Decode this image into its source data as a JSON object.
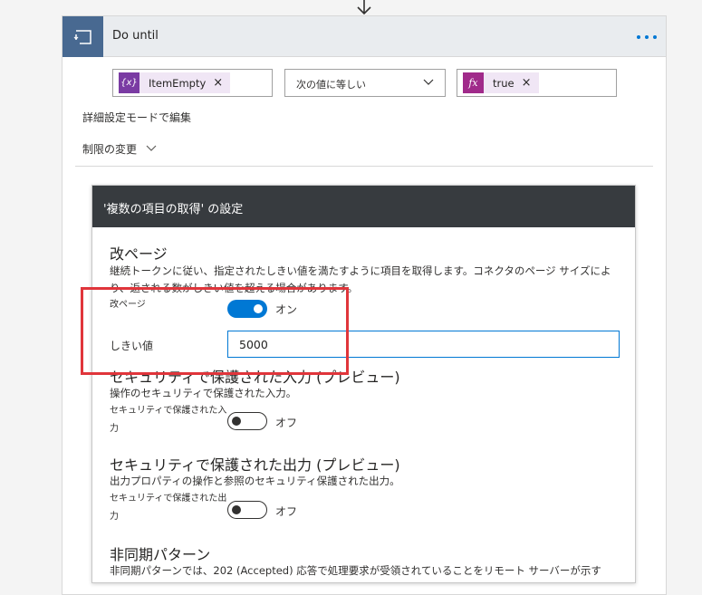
{
  "card": {
    "title": "Do until",
    "condition": {
      "left_token": "ItemEmpty",
      "left_token_icon": "{x}",
      "operator": "次の値に等しい",
      "right_token": "true",
      "right_token_icon": "fx",
      "remove_glyph": "×"
    },
    "advanced_mode_link": "詳細設定モードで編集",
    "change_limits_link": "制限の変更"
  },
  "settings": {
    "header": "'複数の項目の取得' の設定",
    "pagination": {
      "title": "改ページ",
      "description": "継続トークンに従い、指定されたしきい値を満たすように項目を取得します。コネクタのページ サイズにより、返される数がしきい値を超える場合があります。",
      "toggle_label": "改ページ",
      "toggle_state": "オン",
      "threshold_label": "しきい値",
      "threshold_value": "5000"
    },
    "secure_inputs": {
      "title": "セキュリティで保護された入力 (プレビュー)",
      "description": "操作のセキュリティで保護された入力。",
      "toggle_label_line1": "セキュリティで保護された入",
      "toggle_label_line2": "力",
      "toggle_state": "オフ"
    },
    "secure_outputs": {
      "title": "セキュリティで保護された出力 (プレビュー)",
      "description": "出力プロパティの操作と参照のセキュリティ保護された出力。",
      "toggle_label_line1": "セキュリティで保護された出",
      "toggle_label_line2": "力",
      "toggle_state": "オフ"
    },
    "async": {
      "title": "非同期パターン",
      "description": "非同期パターンでは、202 (Accepted) 応答で処理要求が受領されていることをリモート サーバーが示す"
    }
  },
  "colors": {
    "loop_icon_bg": "#486991",
    "variable_token": "#7a3ba3",
    "expression_token": "#a02a8a",
    "accent": "#0078d4",
    "highlight": "#e0353b",
    "settings_header_bg": "#373b3f"
  }
}
